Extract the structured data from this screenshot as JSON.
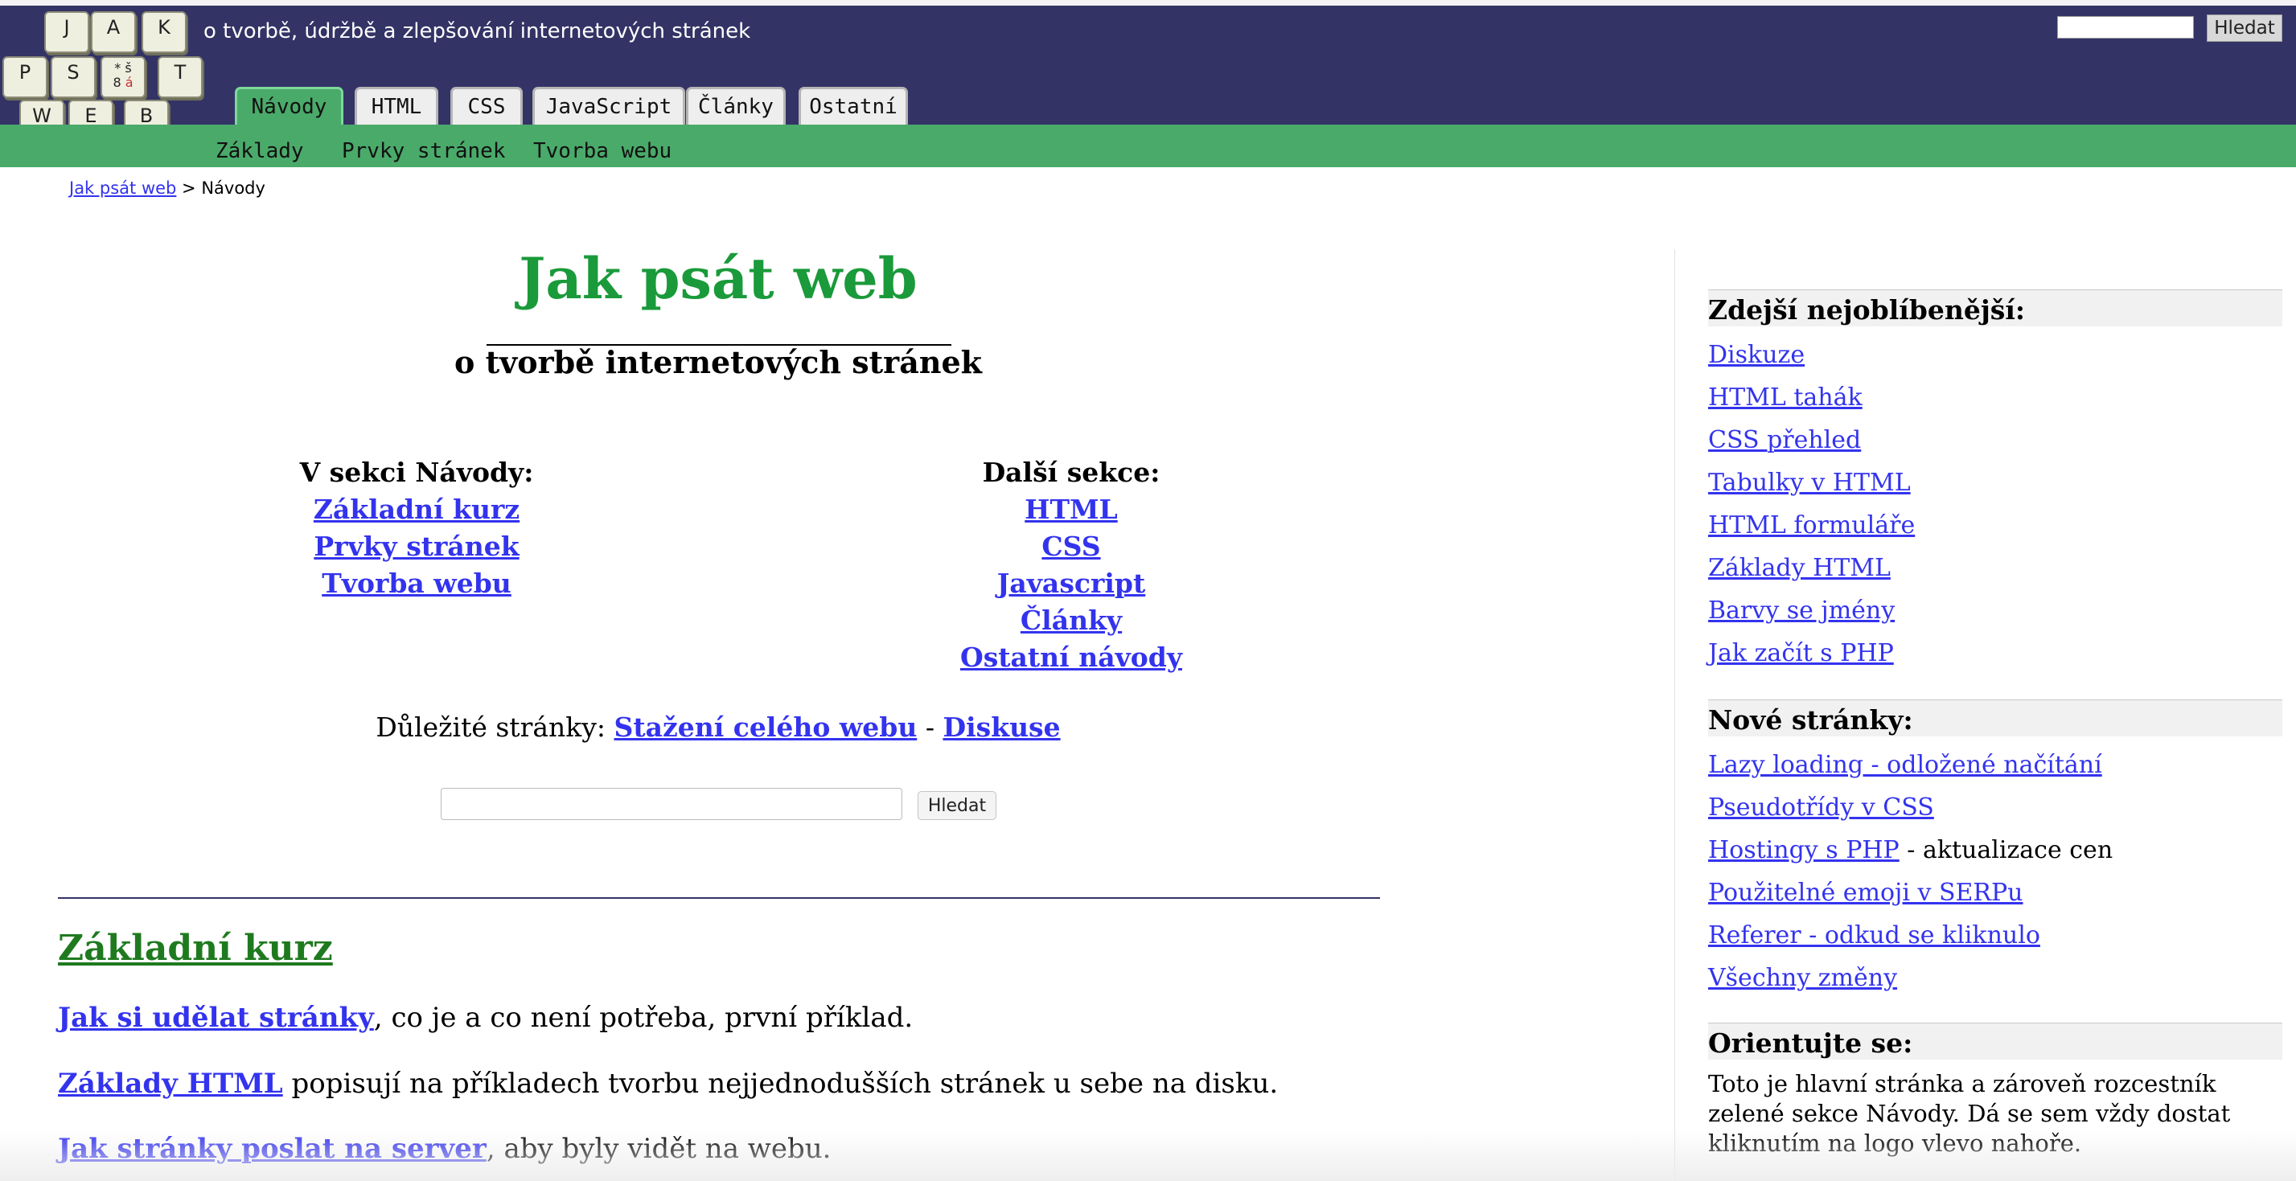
{
  "header": {
    "tagline": "o tvorbě, údržbě a zlepšování internetových stránek",
    "search_button": "Hledat",
    "logo_keys": [
      "J",
      "A",
      "K",
      "P",
      "S",
      "T",
      "W",
      "E",
      "B"
    ],
    "logo_special_key": {
      "top": "* š",
      "mid": "8",
      "right": "á"
    }
  },
  "tabs": [
    {
      "label": "Návody",
      "active": true
    },
    {
      "label": "HTML"
    },
    {
      "label": "CSS"
    },
    {
      "label": "JavaScript"
    },
    {
      "label": "Články"
    },
    {
      "label": "Ostatní"
    }
  ],
  "subnav": [
    "Základy",
    "Prvky stránek",
    "Tvorba webu"
  ],
  "breadcrumb": {
    "home": "Jak psát web",
    "separator": " > ",
    "current": "Návody"
  },
  "main": {
    "title": "Jak psát web",
    "subtitle": "o tvorbě internetových stránek",
    "section_col": {
      "heading": "V sekci Návody:",
      "links": [
        "Základní kurz",
        "Prvky stránek",
        "Tvorba webu"
      ]
    },
    "other_col": {
      "heading": "Další sekce:",
      "links": [
        "HTML",
        "CSS",
        "Javascript",
        "Články",
        "Ostatní návody"
      ]
    },
    "important": {
      "prefix": "Důležité stránky: ",
      "link1": "Stažení celého webu",
      "sep": " - ",
      "link2": "Diskuse"
    },
    "search_button": "Hledat",
    "section_heading": "Základní kurz",
    "paragraphs": [
      {
        "link": "Jak si udělat stránky",
        "text": ", co je a co není potřeba, první příklad."
      },
      {
        "link": "Základy HTML",
        "text": " popisují na příkladech tvorbu nejjednodušších stránek u sebe na disku."
      },
      {
        "link": "Jak stránky poslat na server",
        "text": ", aby byly vidět na webu."
      }
    ]
  },
  "sidebar": {
    "popular_heading": "Zdejší nejoblíbenější:",
    "popular": [
      "Diskuze",
      "HTML tahák",
      "CSS přehled",
      "Tabulky v HTML",
      "HTML formuláře",
      "Základy HTML",
      "Barvy se jmény",
      "Jak začít s PHP"
    ],
    "new_heading": "Nové stránky:",
    "new_pages": [
      {
        "link": "Lazy loading - odložené načítání",
        "suffix": ""
      },
      {
        "link": "Pseudotřídy v CSS",
        "suffix": ""
      },
      {
        "link": "Hostingy s PHP",
        "suffix": " - aktualizace cen"
      },
      {
        "link": "Použitelné emoji v SERPu",
        "suffix": ""
      },
      {
        "link": "Referer - odkud se kliknulo",
        "suffix": ""
      },
      {
        "link": "Všechny změny",
        "suffix": ""
      }
    ],
    "orient_heading": "Orientujte se:",
    "orient_text": "Toto je hlavní stránka a zároveň rozcestník zelené sekce Návody. Dá se sem vždy dostat kliknutím na logo vlevo nahoře."
  },
  "colors": {
    "header_bg": "#333366",
    "nav_green": "#4aaa6a",
    "title_green": "#1a9a3a",
    "link_blue": "#3333ee"
  }
}
